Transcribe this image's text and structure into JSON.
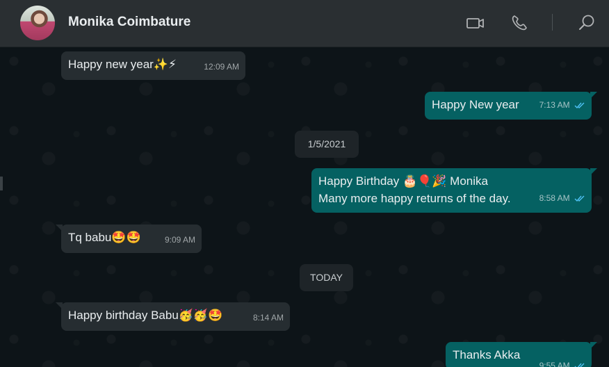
{
  "header": {
    "contact_name": "Monika Coimbature",
    "icons": [
      "video-call-icon",
      "voice-call-icon",
      "search-icon"
    ]
  },
  "messages": [
    {
      "id": "m1",
      "direction": "incoming",
      "text": "Happy new year✨⚡",
      "time": "12:09 AM"
    },
    {
      "id": "m2",
      "direction": "outgoing",
      "text": "Happy New year",
      "time": "7:13 AM",
      "status": "read"
    },
    {
      "id": "d1",
      "type": "date",
      "text": "1/5/2021"
    },
    {
      "id": "m3",
      "direction": "outgoing",
      "lines": [
        "Happy Birthday 🎂🎈🎉 Monika",
        "Many more happy returns of the day."
      ],
      "time": "8:58 AM",
      "status": "read"
    },
    {
      "id": "m4",
      "direction": "incoming",
      "text": "Tq babu🤩🤩",
      "time": "9:09 AM"
    },
    {
      "id": "d2",
      "type": "date",
      "text": "TODAY"
    },
    {
      "id": "m5",
      "direction": "incoming",
      "text": "Happy birthday Babu🥳🥳🤩",
      "time": "8:14 AM"
    },
    {
      "id": "m6",
      "direction": "outgoing",
      "text": "Thanks Akka",
      "time": "9:55 AM",
      "status": "read"
    }
  ],
  "colors": {
    "header_bg": "#2a2f32",
    "chat_bg": "#0d1418",
    "incoming_bubble": "#262d31",
    "outgoing_bubble": "#056162",
    "read_ticks": "#4fc3f7"
  }
}
